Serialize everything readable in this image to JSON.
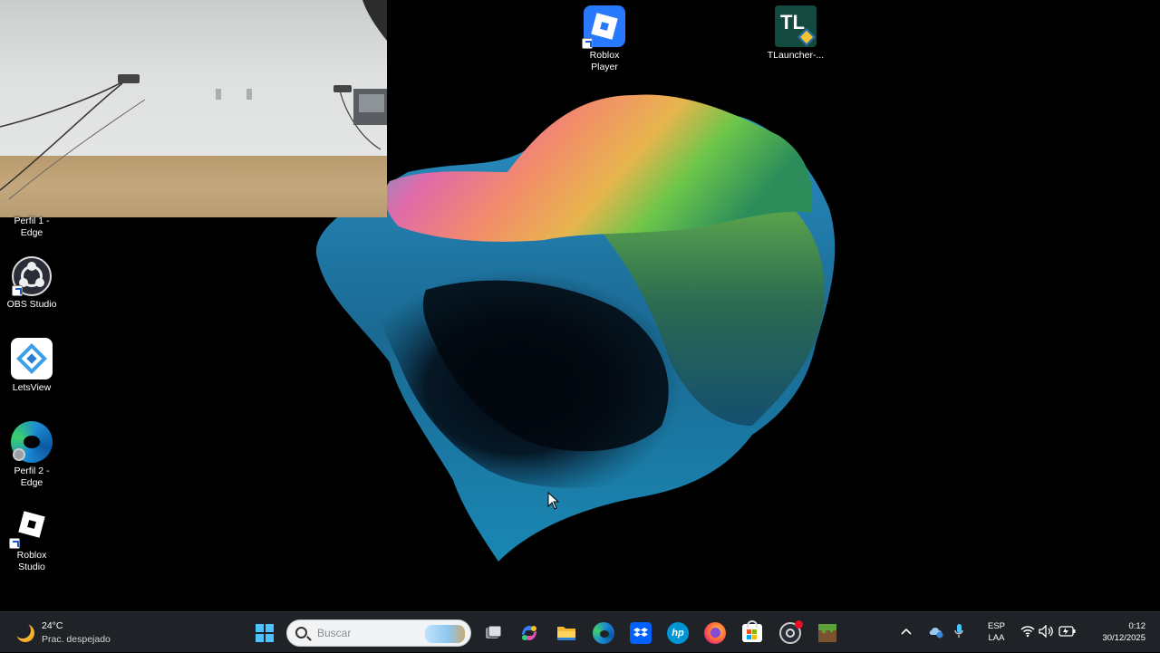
{
  "desktop": {
    "icons": [
      {
        "id": "roblox-player",
        "label": "Roblox\nPlayer"
      },
      {
        "id": "tlauncher",
        "label": "TLauncher-..."
      },
      {
        "id": "perfil1-edge",
        "label": "Perfil 1 -\nEdge"
      },
      {
        "id": "obs-studio",
        "label": "OBS Studio"
      },
      {
        "id": "letsview",
        "label": "LetsView"
      },
      {
        "id": "perfil2-edge",
        "label": "Perfil 2 -\nEdge"
      },
      {
        "id": "roblox-studio",
        "label": "Roblox\nStudio"
      }
    ]
  },
  "taskbar": {
    "weather": {
      "temp": "24°C",
      "desc": "Prac. despejado",
      "icon": "moon-sun-icon"
    },
    "search": {
      "placeholder": "Buscar"
    },
    "apps": [
      "windows-start-icon",
      "search-box",
      "task-view-icon",
      "copilot-icon",
      "file-explorer-icon",
      "edge-icon",
      "dropbox-icon",
      "hp-icon",
      "firefox-icon",
      "microsoft-store-icon",
      "obs-icon",
      "minecraft-icon"
    ],
    "tray": {
      "lang_top": "ESP",
      "lang_bottom": "LAA",
      "time": "0:12",
      "date": "30/12/2025"
    }
  },
  "colors": {
    "taskbar_bg": "#1f2227",
    "desktop_bg": "#000000",
    "accent": "#0078d4"
  }
}
